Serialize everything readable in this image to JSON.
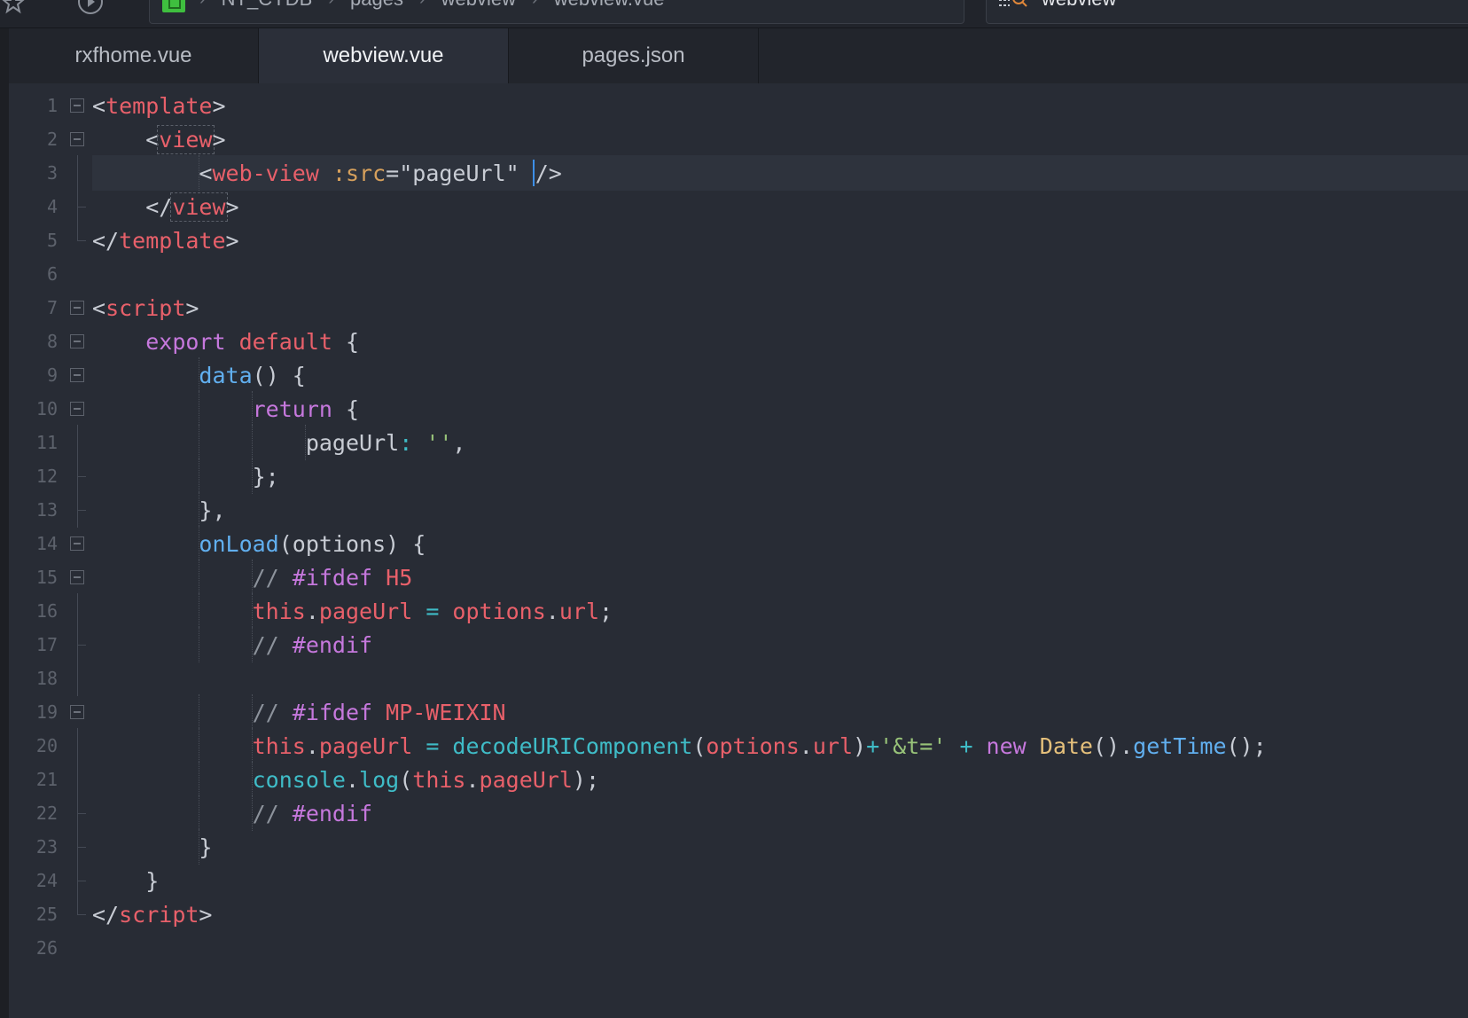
{
  "toolbar": {
    "breadcrumb": [
      "NT_CYDB",
      "pages",
      "webview",
      "webview.vue"
    ],
    "search_value": "webview"
  },
  "tabs": [
    {
      "label": "rxfhome.vue",
      "active": false
    },
    {
      "label": "webview.vue",
      "active": true
    },
    {
      "label": "pages.json",
      "active": false
    }
  ],
  "editor": {
    "current_line": 3,
    "line_numbers": [
      "1",
      "2",
      "3",
      "4",
      "5",
      "6",
      "7",
      "8",
      "9",
      "10",
      "11",
      "12",
      "13",
      "14",
      "15",
      "16",
      "17",
      "18",
      "19",
      "20",
      "21",
      "22",
      "23",
      "24",
      "25",
      "26"
    ],
    "lines": [
      [
        [
          "<",
          "punc"
        ],
        [
          "template",
          "tag"
        ],
        [
          ">",
          "punc"
        ]
      ],
      [
        [
          "    ",
          "plain"
        ],
        [
          "<",
          "punc"
        ],
        [
          "view",
          "tag"
        ],
        [
          ">",
          "punc"
        ]
      ],
      [
        [
          "        <",
          "punc"
        ],
        [
          "web-view",
          "tag"
        ],
        [
          " ",
          "plain"
        ],
        [
          ":src",
          "attr"
        ],
        [
          "=\"pageUrl\" ",
          "str"
        ],
        [
          "/>",
          "punc"
        ]
      ],
      [
        [
          "    ",
          "plain"
        ],
        [
          "</",
          "punc"
        ],
        [
          "view",
          "tag"
        ],
        [
          ">",
          "punc"
        ]
      ],
      [
        [
          "</",
          "punc"
        ],
        [
          "template",
          "tag"
        ],
        [
          ">",
          "punc"
        ]
      ],
      [],
      [
        [
          "<",
          "punc"
        ],
        [
          "script",
          "tag"
        ],
        [
          ">",
          "punc"
        ]
      ],
      [
        [
          "    ",
          "plain"
        ],
        [
          "export",
          "kw"
        ],
        [
          " ",
          "plain"
        ],
        [
          "default",
          "red"
        ],
        [
          " {",
          "punc"
        ]
      ],
      [
        [
          "        ",
          "plain"
        ],
        [
          "data",
          "fn"
        ],
        [
          "() {",
          "punc"
        ]
      ],
      [
        [
          "            ",
          "plain"
        ],
        [
          "return",
          "kw"
        ],
        [
          " {",
          "punc"
        ]
      ],
      [
        [
          "                ",
          "plain"
        ],
        [
          "pageUrl",
          "plain"
        ],
        [
          ":",
          "cyan"
        ],
        [
          " ",
          "plain"
        ],
        [
          "''",
          "green"
        ],
        [
          ",",
          "punc"
        ]
      ],
      [
        [
          "            ",
          "plain"
        ],
        [
          "};",
          "punc"
        ]
      ],
      [
        [
          "        ",
          "plain"
        ],
        [
          "},",
          "punc"
        ]
      ],
      [
        [
          "        ",
          "plain"
        ],
        [
          "onLoad",
          "fn"
        ],
        [
          "(options) {",
          "punc"
        ]
      ],
      [
        [
          "            ",
          "plain"
        ],
        [
          "// ",
          "comment"
        ],
        [
          "#ifdef",
          "kw"
        ],
        [
          " H5",
          "red"
        ]
      ],
      [
        [
          "            ",
          "plain"
        ],
        [
          "this",
          "red"
        ],
        [
          ".",
          "punc"
        ],
        [
          "pageUrl",
          "red"
        ],
        [
          " = ",
          "cyan"
        ],
        [
          "options",
          "red"
        ],
        [
          ".",
          "punc"
        ],
        [
          "url",
          "red"
        ],
        [
          ";",
          "punc"
        ]
      ],
      [
        [
          "            ",
          "plain"
        ],
        [
          "// ",
          "comment"
        ],
        [
          "#endif",
          "kw"
        ]
      ],
      [],
      [
        [
          "            ",
          "plain"
        ],
        [
          "// ",
          "comment"
        ],
        [
          "#ifdef",
          "kw"
        ],
        [
          " MP-WEIXIN",
          "red"
        ]
      ],
      [
        [
          "            ",
          "plain"
        ],
        [
          "this",
          "red"
        ],
        [
          ".",
          "punc"
        ],
        [
          "pageUrl",
          "red"
        ],
        [
          " = ",
          "cyan"
        ],
        [
          "decodeURIComponent",
          "cyan"
        ],
        [
          "(",
          "punc"
        ],
        [
          "options",
          "red"
        ],
        [
          ".",
          "punc"
        ],
        [
          "url",
          "red"
        ],
        [
          ")",
          "punc"
        ],
        [
          "+",
          "cyan"
        ],
        [
          "'&t='",
          "green"
        ],
        [
          " + ",
          "cyan"
        ],
        [
          "new",
          "kw"
        ],
        [
          " ",
          "plain"
        ],
        [
          "Date",
          "yellow"
        ],
        [
          "().",
          "punc"
        ],
        [
          "getTime",
          "fn"
        ],
        [
          "();",
          "punc"
        ]
      ],
      [
        [
          "            ",
          "plain"
        ],
        [
          "console",
          "cyan"
        ],
        [
          ".",
          "punc"
        ],
        [
          "log",
          "cyan"
        ],
        [
          "(",
          "punc"
        ],
        [
          "this",
          "red"
        ],
        [
          ".",
          "punc"
        ],
        [
          "pageUrl",
          "red"
        ],
        [
          ");",
          "punc"
        ]
      ],
      [
        [
          "            ",
          "plain"
        ],
        [
          "// ",
          "comment"
        ],
        [
          "#endif",
          "kw"
        ]
      ],
      [
        [
          "        ",
          "plain"
        ],
        [
          "}",
          "punc"
        ]
      ],
      [
        [
          "    ",
          "plain"
        ],
        [
          "}",
          "punc"
        ]
      ],
      [
        [
          "</",
          "punc"
        ],
        [
          "script",
          "tag"
        ],
        [
          ">",
          "punc"
        ]
      ],
      []
    ],
    "folds": [
      "box",
      "box",
      "line",
      "tick",
      "end",
      "",
      "box",
      "box",
      "box",
      "box",
      "line",
      "tick",
      "tick",
      "box",
      "box",
      "line",
      "tick",
      "line",
      "box",
      "line",
      "line",
      "tick",
      "tick",
      "tick",
      "end",
      ""
    ]
  }
}
